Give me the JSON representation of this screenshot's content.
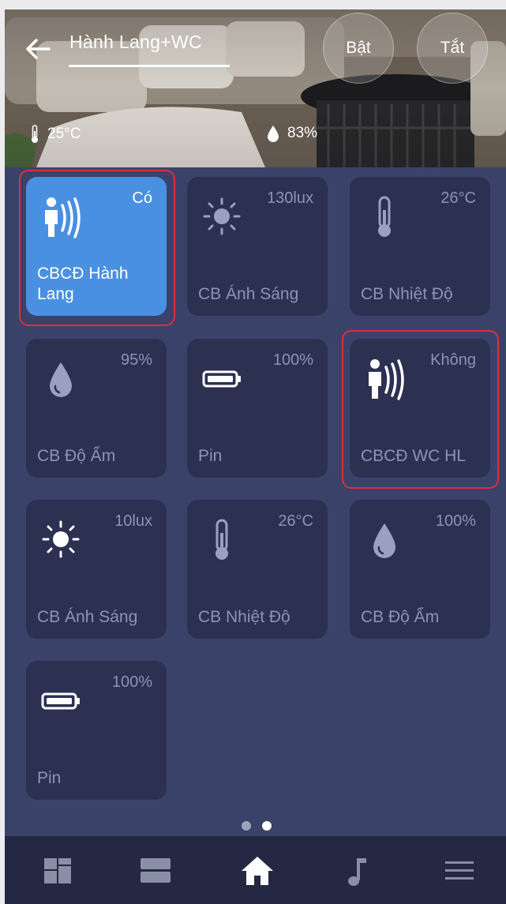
{
  "header": {
    "title": "Hành Lang+WC",
    "on_label": "Bật",
    "off_label": "Tắt",
    "temperature": "25°C",
    "humidity": "83%"
  },
  "tiles": [
    {
      "label": "CBCĐ Hành Lang",
      "value": "Có",
      "icon": "motion-sensor-icon",
      "active": true
    },
    {
      "label": "CB Ánh Sáng",
      "value": "130lux",
      "icon": "sun-icon"
    },
    {
      "label": "CB Nhiệt Độ",
      "value": "26°C",
      "icon": "thermometer-icon"
    },
    {
      "label": "CB Độ Ẩm",
      "value": "95%",
      "icon": "water-drop-icon"
    },
    {
      "label": "Pin",
      "value": "100%",
      "icon": "battery-icon"
    },
    {
      "label": "CBCĐ WC HL",
      "value": "Không",
      "icon": "motion-sensor-icon"
    },
    {
      "label": "CB Ánh Sáng",
      "value": "10lux",
      "icon": "sun-icon"
    },
    {
      "label": "CB Nhiệt Độ",
      "value": "26°C",
      "icon": "thermometer-icon"
    },
    {
      "label": "CB Độ Ẩm",
      "value": "100%",
      "icon": "water-drop-icon"
    },
    {
      "label": "Pin",
      "value": "100%",
      "icon": "battery-icon"
    }
  ],
  "pager": {
    "pages": 2,
    "current": 2
  },
  "nav": [
    {
      "icon": "dashboard-icon"
    },
    {
      "icon": "rooms-icon"
    },
    {
      "icon": "home-icon",
      "active": true
    },
    {
      "icon": "music-note-icon"
    },
    {
      "icon": "menu-icon"
    }
  ],
  "colors": {
    "background": "#3b426a",
    "tile": "#2c3152",
    "tile_active": "#4a90e2",
    "highlight": "#d8303d",
    "nav_bar": "#242843"
  }
}
